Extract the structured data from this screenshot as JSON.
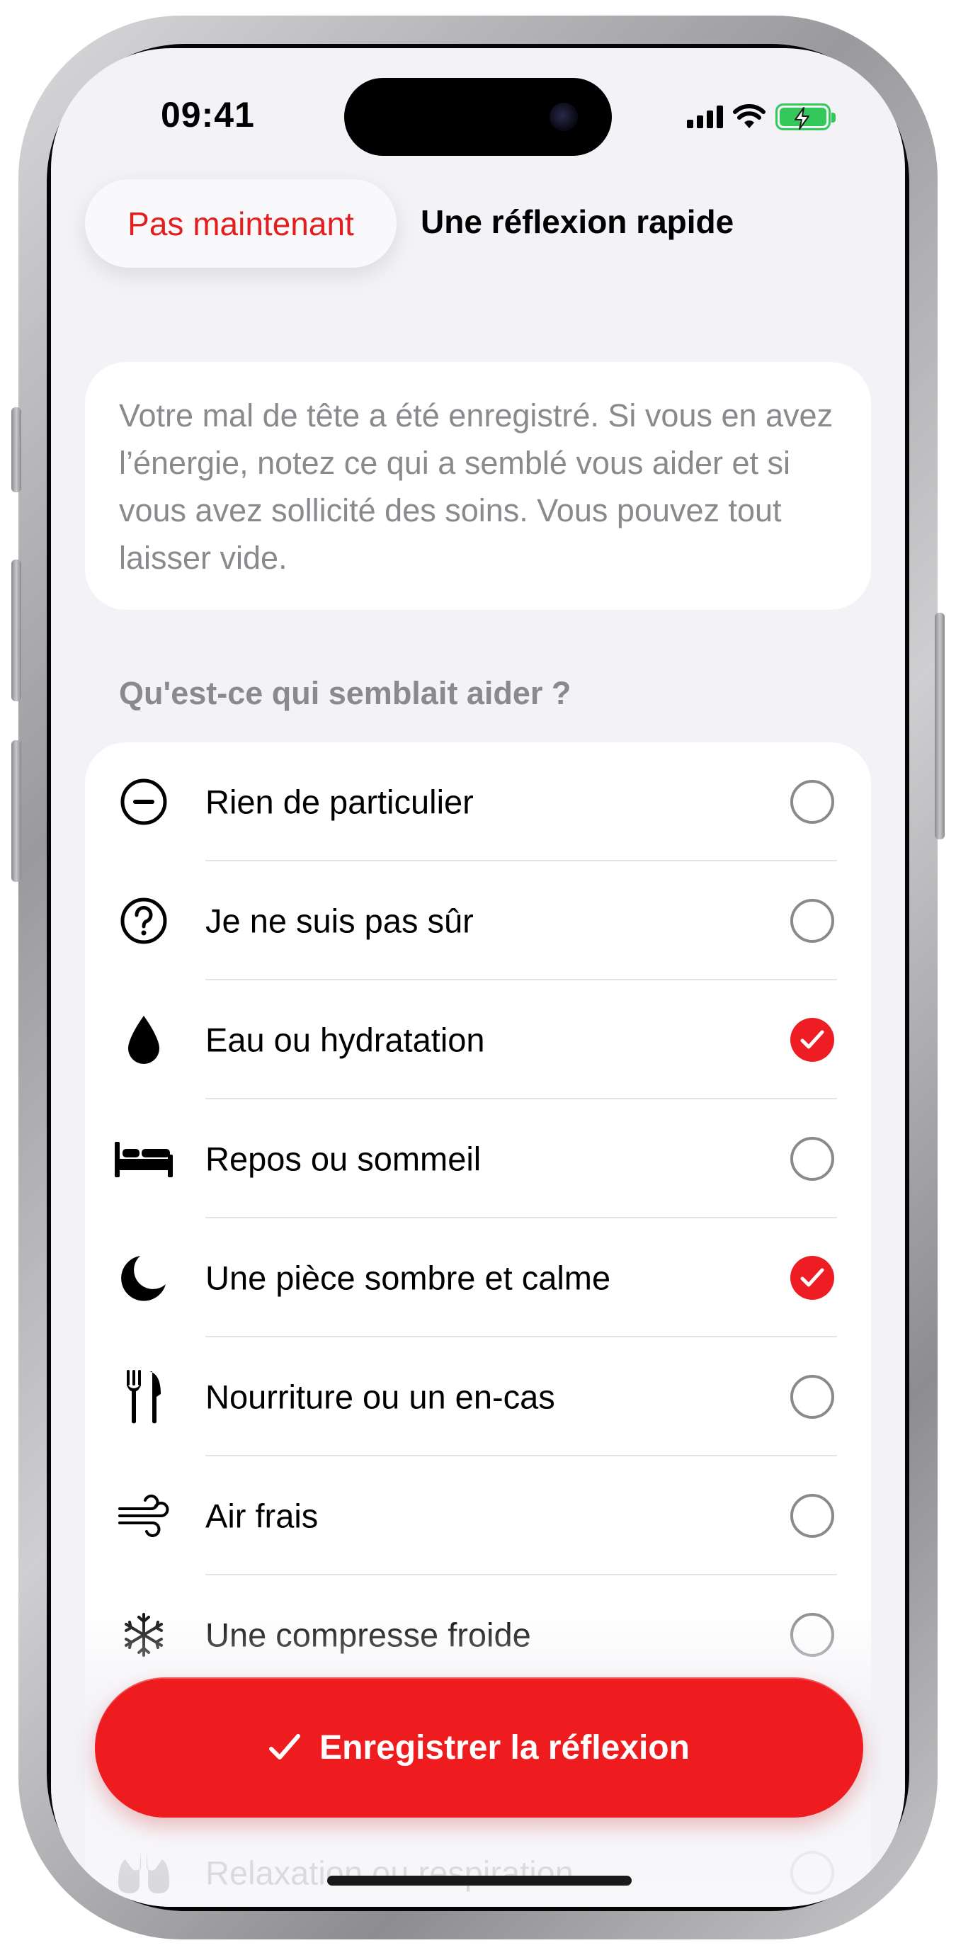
{
  "status_bar": {
    "time": "09:41"
  },
  "nav": {
    "cancel_label": "Pas maintenant",
    "title": "Une réflexion rapide"
  },
  "info": {
    "text": "Votre mal de tête a été enregistré. Si vous en avez l’énergie, notez ce qui a semblé vous aider et si vous avez sollicité des soins. Vous pouvez tout laisser vide."
  },
  "section": {
    "header": "Qu'est-ce qui semblait aider ?"
  },
  "options": [
    {
      "label": "Rien de particulier",
      "icon": "minus-circle-icon",
      "checked": false
    },
    {
      "label": "Je ne suis pas sûr",
      "icon": "question-circle-icon",
      "checked": false
    },
    {
      "label": "Eau ou hydratation",
      "icon": "drop-icon",
      "checked": true
    },
    {
      "label": "Repos ou sommeil",
      "icon": "bed-icon",
      "checked": false
    },
    {
      "label": "Une pièce sombre et calme",
      "icon": "moon-icon",
      "checked": true
    },
    {
      "label": "Nourriture ou un en-cas",
      "icon": "fork-knife-icon",
      "checked": false
    },
    {
      "label": "Air frais",
      "icon": "wind-icon",
      "checked": false
    },
    {
      "label": "Une compresse froide",
      "icon": "snowflake-icon",
      "checked": false
    },
    {
      "label": "Relaxation ou respiration",
      "icon": "lungs-icon",
      "checked": false
    }
  ],
  "primary_action": {
    "label": "Enregistrer la réflexion"
  },
  "colors": {
    "accent": "#ee1c23",
    "background": "#f2f2f7",
    "secondary_text": "#8a8a8e",
    "battery": "#34c759"
  }
}
